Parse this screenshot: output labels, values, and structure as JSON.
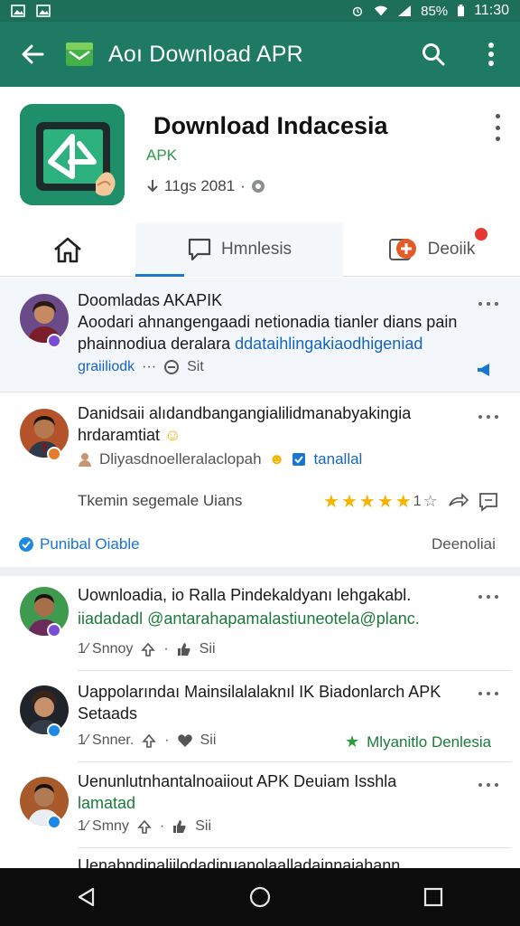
{
  "status_bar": {
    "battery": "85%",
    "time": "11:30"
  },
  "appbar": {
    "title": "Aoı Download APR"
  },
  "app": {
    "name": "Download Indacesia",
    "subtitle": "APK",
    "meta": "11gs 2081"
  },
  "tabs": [
    {
      "label": ""
    },
    {
      "label": "Hmnlesis"
    },
    {
      "label": "Deoiik"
    }
  ],
  "feed": {
    "post1": {
      "title": "Doomladas AKAPIK",
      "body": "Aoodari ahnangengaadi netionadia tianler dians pain",
      "body2_plain": "phainnodiua deralara",
      "body2_link": "ddataihlingakiaodhigeniad",
      "body3_link": "graiiliodk",
      "meta": "Sit"
    },
    "post2": {
      "title": "Danidsaii alıdandbangangialilidmanabyakingia",
      "title2": "hrdaramtiat",
      "body": "Dliyasdnoelleralaclopah",
      "tag": "tanallal",
      "rating_label": "Tkemin segemale Uians",
      "rating_count": "1",
      "footer_left": "Punibal Oiable",
      "footer_right": "Deenoliai"
    },
    "post3": {
      "title": "Uownloadia, io Ralla Pindekaldyanı lehgakabl.",
      "body": "iiadadadl @antarahapamalastiuneotela@planc.",
      "meta_name": "1⁄ Snnoy",
      "meta_action": "Sii"
    },
    "post4": {
      "title": "Uappolarındaı Mainsilalalaknıl IK Biadonlarch APK",
      "title2": "Setaads",
      "meta_name": "1⁄ Snner.",
      "meta_action": "Sii",
      "tag": "Mlyanitlo Denlesia"
    },
    "post5": {
      "title": "Uenunlutnhantalnoaiiout APK Deuiam Isshla",
      "title2": "lamatad",
      "meta_name": "1⁄ Smny",
      "meta_action": "Sii"
    },
    "post6": {
      "title": "Uenabndinaliilodadinuanolaalladainnaiahann"
    }
  },
  "colors": {
    "status_bar": "#1d6f5a",
    "app_bar": "#1e7a62",
    "accent_blue": "#1976d2",
    "accent_green": "#1b7a3a",
    "star": "#f5b400",
    "notification": "#e53935"
  }
}
